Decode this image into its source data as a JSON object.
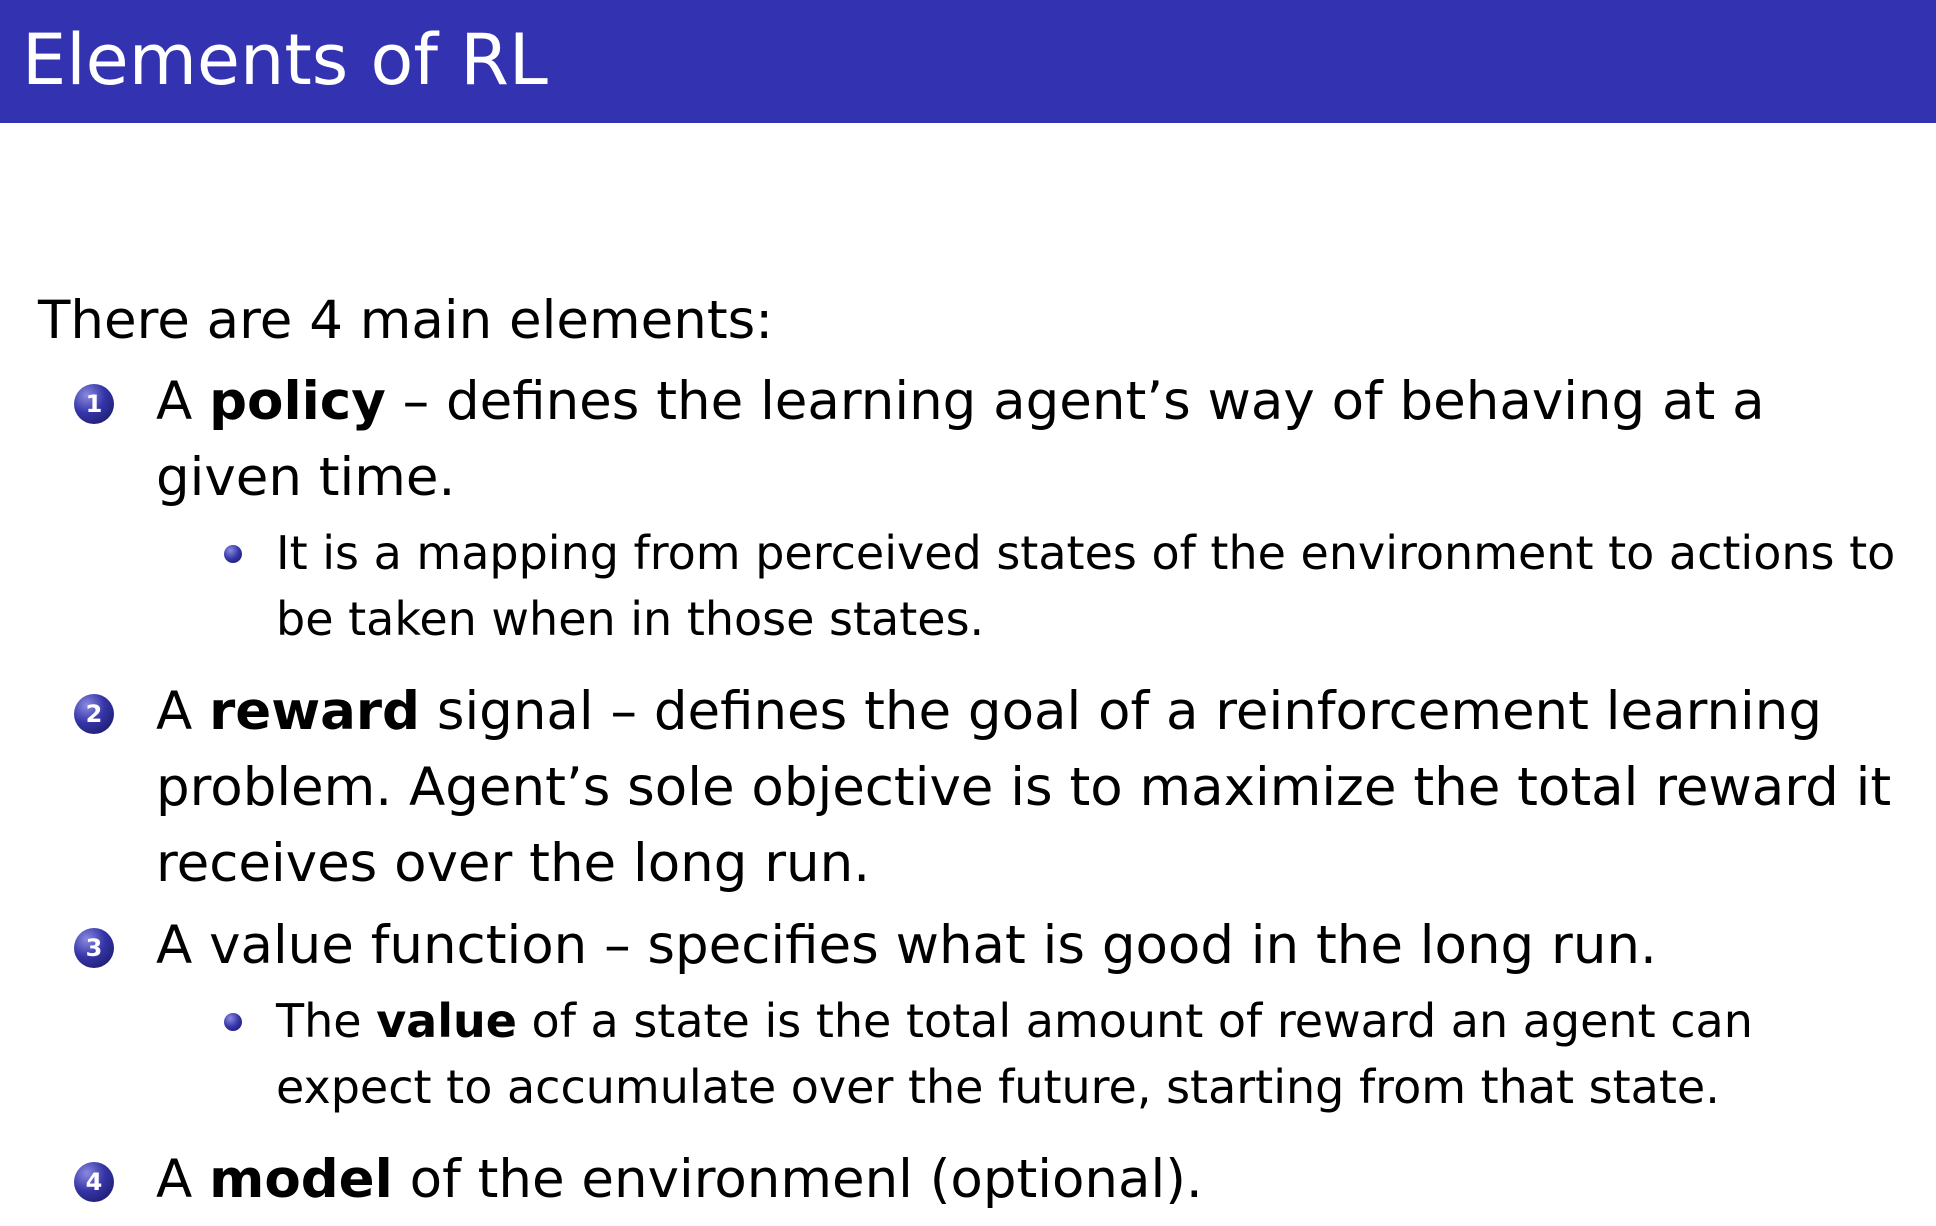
{
  "slide": {
    "title": "Elements of RL"
  },
  "content": {
    "intro": "There are 4 main elements:",
    "items": [
      {
        "number": "1",
        "prefix": "A ",
        "bold": "policy",
        "text": " – defines the learning agent’s way of behaving at a given time.",
        "sub": "It is a mapping from perceived states of the environment to actions to be taken when in those states."
      },
      {
        "number": "2",
        "prefix": "A ",
        "bold": "reward",
        "text": " signal – defines the goal of a reinforcement learning problem. Agent’s sole objective is to maximize the total reward it receives over the long run."
      },
      {
        "number": "3",
        "text": "A value function – specifies what is good in the long run.",
        "sub_prefix": "The ",
        "sub_bold": "value",
        "sub_text": " of a state is the total amount of reward an agent can expect to accumulate over the future, starting from that state."
      },
      {
        "number": "4",
        "prefix": "A ",
        "bold": "model",
        "text": " of the environmenl (optional)."
      }
    ]
  },
  "colors": {
    "header_bg": "#3333b2",
    "title_text": "#ffffff",
    "bullet": "#3535a8"
  }
}
